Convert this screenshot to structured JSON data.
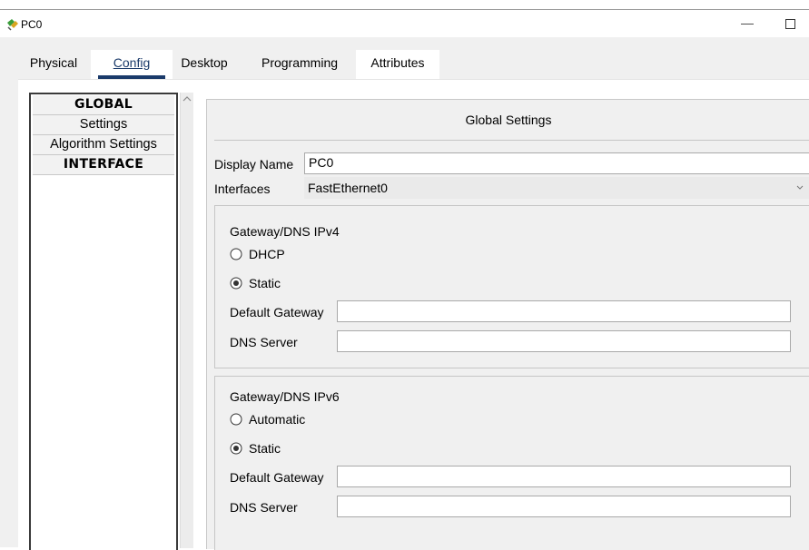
{
  "window": {
    "title": "PC0",
    "minimize_glyph": "—"
  },
  "tabs": [
    {
      "label": "Physical"
    },
    {
      "label": "Config"
    },
    {
      "label": "Desktop"
    },
    {
      "label": "Programming"
    },
    {
      "label": "Attributes"
    }
  ],
  "sidebar": {
    "items": [
      {
        "label": "GLOBAL"
      },
      {
        "label": "Settings"
      },
      {
        "label": "Algorithm Settings"
      },
      {
        "label": "INTERFACE"
      }
    ]
  },
  "main": {
    "heading": "Global Settings",
    "display_name_label": "Display Name",
    "display_name_value": "PC0",
    "interfaces_label": "Interfaces",
    "interfaces_value": "FastEthernet0",
    "ipv4": {
      "title": "Gateway/DNS IPv4",
      "option_dhcp": "DHCP",
      "option_static": "Static",
      "selected": "Static",
      "default_gateway_label": "Default Gateway",
      "default_gateway_value": "",
      "dns_server_label": "DNS Server",
      "dns_server_value": ""
    },
    "ipv6": {
      "title": "Gateway/DNS IPv6",
      "option_automatic": "Automatic",
      "option_static": "Static",
      "selected": "Static",
      "default_gateway_label": "Default Gateway",
      "default_gateway_value": "",
      "dns_server_label": "DNS Server",
      "dns_server_value": ""
    }
  },
  "colors": {
    "active_tab_underline": "#1a3a6a",
    "panel_bg": "#f0f0f0",
    "nav_border": "#3a3a3a"
  },
  "icons": {
    "app": "packet-tracer-pc-icon",
    "scroll_up": "scroll-up-arrow-icon",
    "dropdown": "chevron-down-icon"
  }
}
